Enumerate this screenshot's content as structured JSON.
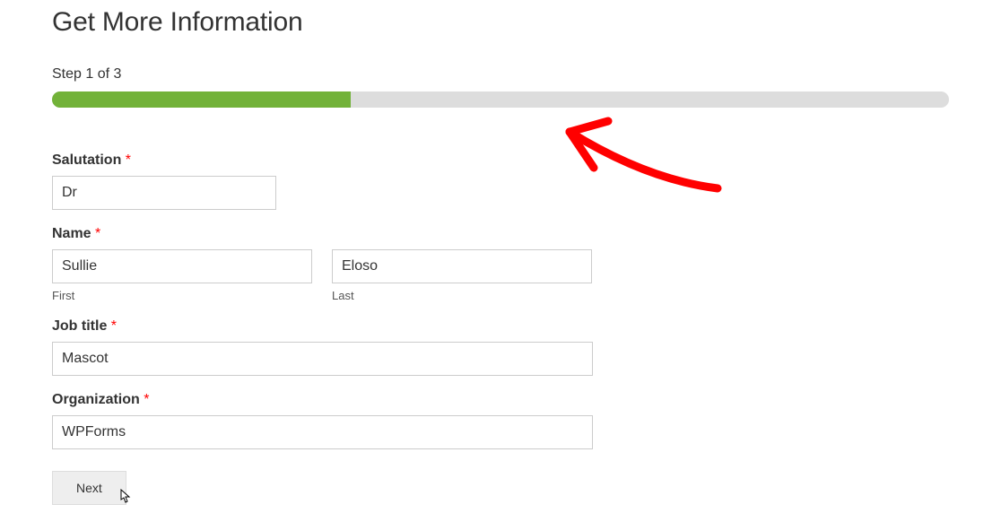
{
  "form": {
    "title": "Get More Information",
    "step_indicator": "Step 1 of 3",
    "progress_percent": 33.3,
    "fields": {
      "salutation": {
        "label": "Salutation",
        "required": true,
        "value": "Dr"
      },
      "name": {
        "label": "Name",
        "required": true,
        "first": {
          "value": "Sullie",
          "sublabel": "First"
        },
        "last": {
          "value": "Eloso",
          "sublabel": "Last"
        }
      },
      "jobtitle": {
        "label": "Job title",
        "required": true,
        "value": "Mascot"
      },
      "organization": {
        "label": "Organization",
        "required": true,
        "value": "WPForms"
      }
    },
    "buttons": {
      "next": "Next"
    }
  },
  "colors": {
    "progress_bg": "#ddd",
    "progress_fill": "#72b239",
    "required": "#ff0000"
  }
}
